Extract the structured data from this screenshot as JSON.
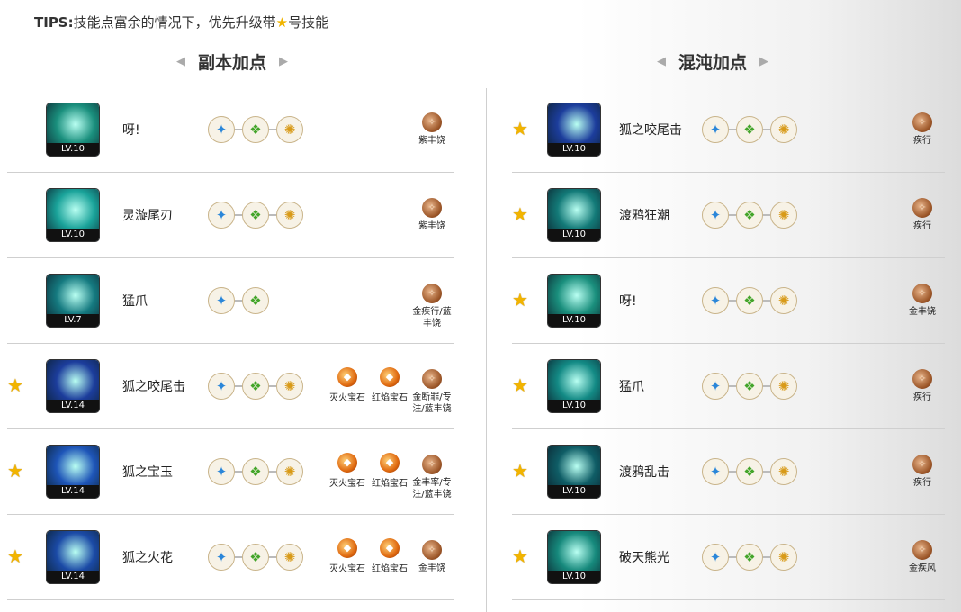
{
  "tips": {
    "prefix": "TIPS:",
    "before": "技能点富余的情况下，优先升级带",
    "star": "★",
    "after": "号技能"
  },
  "left": {
    "title": "副本加点",
    "rows": [
      {
        "star": false,
        "level": "LV.10",
        "name": "呀!",
        "runes": [
          "blue",
          "green",
          "gold"
        ],
        "gems": [],
        "seal": "紫丰饶"
      },
      {
        "star": false,
        "level": "LV.10",
        "name": "灵漩尾刃",
        "runes": [
          "blue",
          "green",
          "gold"
        ],
        "gems": [],
        "seal": "紫丰饶"
      },
      {
        "star": false,
        "level": "LV.7",
        "name": "猛爪",
        "runes": [
          "blue",
          "green"
        ],
        "gems": [],
        "seal": "金疾行/蓝丰饶"
      },
      {
        "star": true,
        "level": "LV.14",
        "name": "狐之咬尾击",
        "runes": [
          "blue",
          "green",
          "gold"
        ],
        "gems": [
          "灭火宝石",
          "红焰宝石"
        ],
        "seal": "金断罪/专注/蓝丰饶"
      },
      {
        "star": true,
        "level": "LV.14",
        "name": "狐之宝玉",
        "runes": [
          "blue",
          "green",
          "gold"
        ],
        "gems": [
          "灭火宝石",
          "红焰宝石"
        ],
        "seal": "金丰率/专注/蓝丰饶"
      },
      {
        "star": true,
        "level": "LV.14",
        "name": "狐之火花",
        "runes": [
          "blue",
          "green",
          "gold"
        ],
        "gems": [
          "灭火宝石",
          "红焰宝石"
        ],
        "seal": "金丰饶"
      }
    ]
  },
  "right": {
    "title": "混沌加点",
    "rows": [
      {
        "star": true,
        "level": "LV.10",
        "name": "狐之咬尾击",
        "runes": [
          "blue",
          "green",
          "gold"
        ],
        "seal": "疾行"
      },
      {
        "star": true,
        "level": "LV.10",
        "name": "渡鸦狂潮",
        "runes": [
          "blue",
          "green",
          "gold"
        ],
        "seal": "疾行"
      },
      {
        "star": true,
        "level": "LV.10",
        "name": "呀!",
        "runes": [
          "blue",
          "green",
          "gold"
        ],
        "seal": "金丰饶"
      },
      {
        "star": true,
        "level": "LV.10",
        "name": "猛爪",
        "runes": [
          "blue",
          "green",
          "gold"
        ],
        "seal": "疾行"
      },
      {
        "star": true,
        "level": "LV.10",
        "name": "渡鸦乱击",
        "runes": [
          "blue",
          "green",
          "gold"
        ],
        "seal": "疾行"
      },
      {
        "star": true,
        "level": "LV.10",
        "name": "破天熊光",
        "runes": [
          "blue",
          "green",
          "gold"
        ],
        "seal": "金疾风"
      }
    ]
  }
}
